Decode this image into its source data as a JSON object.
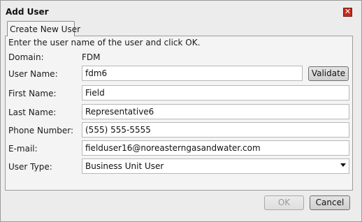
{
  "window": {
    "title": "Add User",
    "close_symbol": "✕"
  },
  "tab": {
    "label": "Create New User"
  },
  "form": {
    "instruction": "Enter the user name of the user and click OK.",
    "domain_label": "Domain:",
    "domain_value": "FDM",
    "username_label": "User Name:",
    "username_value": "fdm6",
    "validate_label": "Validate",
    "firstname_label": "First Name:",
    "firstname_value": "Field",
    "lastname_label": "Last Name:",
    "lastname_value": "Representative6",
    "phone_label": "Phone Number:",
    "phone_value": "(555) 555-5555",
    "email_label": "E-mail:",
    "email_value": "fielduser16@noreasterngasandwater.com",
    "usertype_label": "User Type:",
    "usertype_value": "Business Unit User"
  },
  "footer": {
    "ok_label": "OK",
    "cancel_label": "Cancel"
  },
  "colors": {
    "close_button": "#c42b1c",
    "panel_bg": "#f4f4f4",
    "dialog_bg": "#ececec"
  }
}
